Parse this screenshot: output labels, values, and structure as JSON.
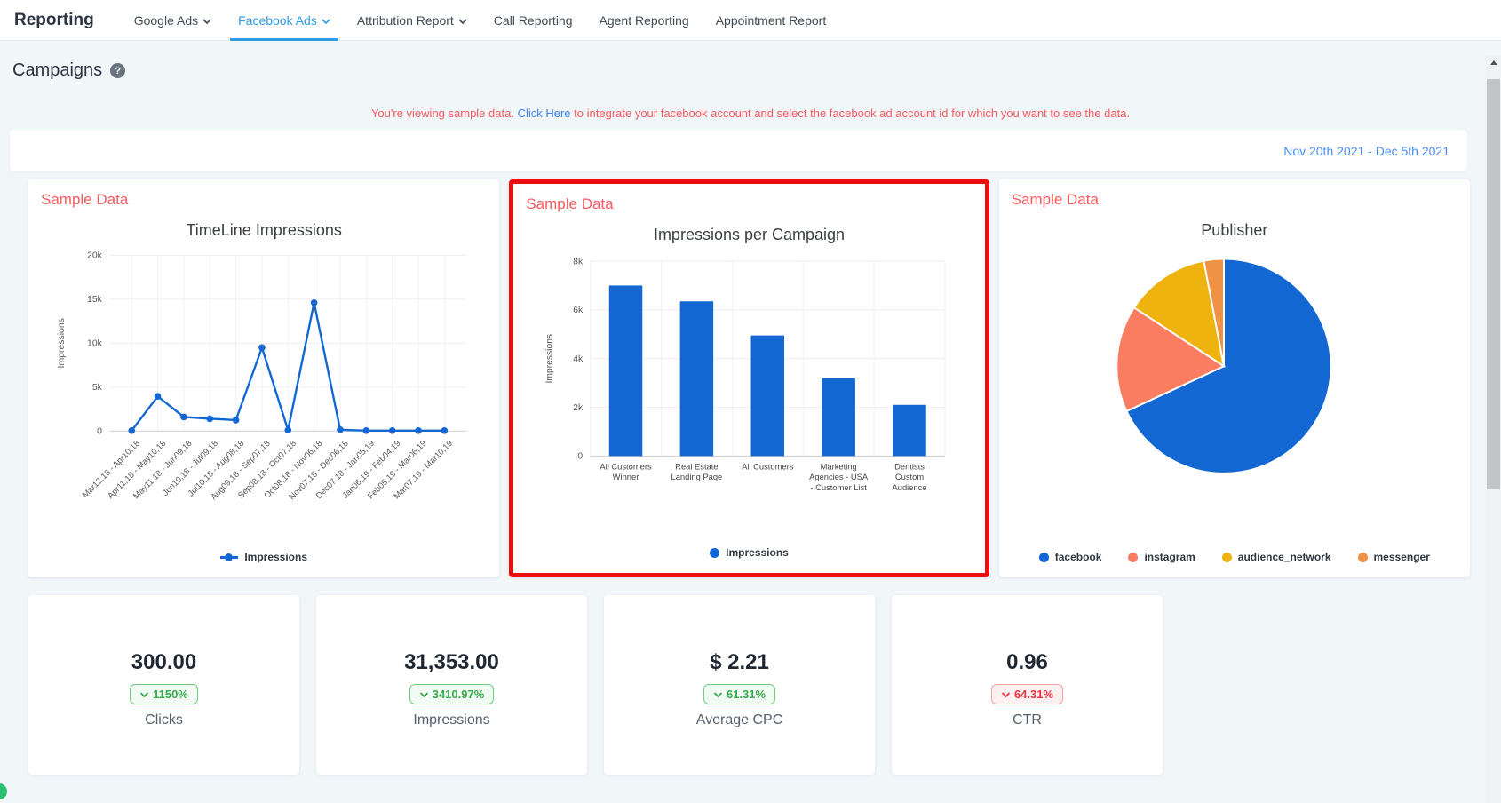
{
  "nav": {
    "title": "Reporting",
    "tabs": [
      {
        "label": "Google Ads",
        "dropdown": true,
        "active": false
      },
      {
        "label": "Facebook Ads",
        "dropdown": true,
        "active": true
      },
      {
        "label": "Attribution Report",
        "dropdown": true,
        "active": false
      },
      {
        "label": "Call Reporting",
        "dropdown": false,
        "active": false
      },
      {
        "label": "Agent Reporting",
        "dropdown": false,
        "active": false
      },
      {
        "label": "Appointment Report",
        "dropdown": false,
        "active": false
      }
    ]
  },
  "page": {
    "heading": "Campaigns",
    "help_glyph": "?",
    "sample_label": "Sample Data",
    "notice": {
      "prefix": "You're viewing sample data.",
      "link": "Click Here",
      "suffix": "to integrate your facebook account and select the facebook ad account id for which you want to see the data."
    },
    "date_range": "Nov 20th 2021 - Dec 5th 2021"
  },
  "colors": {
    "accent_blue": "#1267d2",
    "active_tab_blue": "#2e9ce4",
    "link_blue": "#3b82f6",
    "date_blue": "#4a8cf7",
    "alert_red": "#fb5a5e",
    "highlight_border_red": "#ec0e0e",
    "badge_green": "#36a94c",
    "badge_red": "#e8343d",
    "pie_salmon": "#fa7d62",
    "pie_yellow": "#efb30f",
    "pie_orange": "#ef9244"
  },
  "chart_data": [
    {
      "type": "line",
      "title": "TimeLine Impressions",
      "ylabel": "Impressions",
      "ylim": [
        0,
        20000
      ],
      "ytick_step": 5000,
      "grid": true,
      "legend_position": "bottom",
      "color": "#1267d2",
      "categories": [
        "Mar12,18 - Apr10,18",
        "Apr11,18 - May10,18",
        "May11,18 - Jun09,18",
        "Jun10,18 - Jul09,18",
        "Jul10,18 - Aug08,18",
        "Aug09,18 - Sep07,18",
        "Sep08,18 - Oct07,18",
        "Oct08,18 - Nov06,18",
        "Nov07,18 - Dec06,18",
        "Dec07,18 - Jan05,19",
        "Jan06,19 - Feb04,19",
        "Feb05,19 - Mar06,19",
        "Mar07,19 - Mar10,19"
      ],
      "series": [
        {
          "name": "Impressions",
          "values": [
            50,
            3950,
            1600,
            1400,
            1250,
            9500,
            100,
            14600,
            150,
            50,
            50,
            50,
            50
          ]
        }
      ]
    },
    {
      "type": "bar",
      "title": "Impressions per Campaign",
      "ylabel": "Impressions",
      "ylim": [
        0,
        8000
      ],
      "ytick_step": 2000,
      "grid": true,
      "legend_position": "bottom",
      "color": "#1267d2",
      "highlighted": true,
      "categories": [
        "All Customers Winner",
        "Real Estate Landing Page",
        "All Customers",
        "Marketing Agencies - USA - Customer List",
        "Dentists Custom Audience"
      ],
      "category_lines": [
        [
          "All Customers",
          "Winner"
        ],
        [
          "Real Estate",
          "Landing Page"
        ],
        [
          "All Customers"
        ],
        [
          "Marketing",
          "Agencies - USA",
          "- Customer List"
        ],
        [
          "Dentists",
          "Custom",
          "Audience"
        ]
      ],
      "series": [
        {
          "name": "Impressions",
          "values": [
            7000,
            6350,
            4950,
            3200,
            2100
          ]
        }
      ]
    },
    {
      "type": "pie",
      "title": "Publisher",
      "legend_position": "bottom",
      "slices": [
        {
          "label": "facebook",
          "percent": 68.1,
          "color": "#1267d2"
        },
        {
          "label": "instagram",
          "percent": 16.1,
          "color": "#fa7d62"
        },
        {
          "label": "audience_network",
          "percent": 12.8,
          "color": "#efb30f"
        },
        {
          "label": "messenger",
          "percent": 3.0,
          "color": "#ef9244"
        }
      ]
    }
  ],
  "stats": [
    {
      "value": "300.00",
      "change": "1150%",
      "direction": "down",
      "trend": "positive",
      "label": "Clicks"
    },
    {
      "value": "31,353.00",
      "change": "3410.97%",
      "direction": "down",
      "trend": "positive",
      "label": "Impressions"
    },
    {
      "value": "$ 2.21",
      "change": "61.31%",
      "direction": "down",
      "trend": "positive",
      "label": "Average CPC"
    },
    {
      "value": "0.96",
      "change": "64.31%",
      "direction": "down",
      "trend": "negative",
      "label": "CTR"
    }
  ]
}
